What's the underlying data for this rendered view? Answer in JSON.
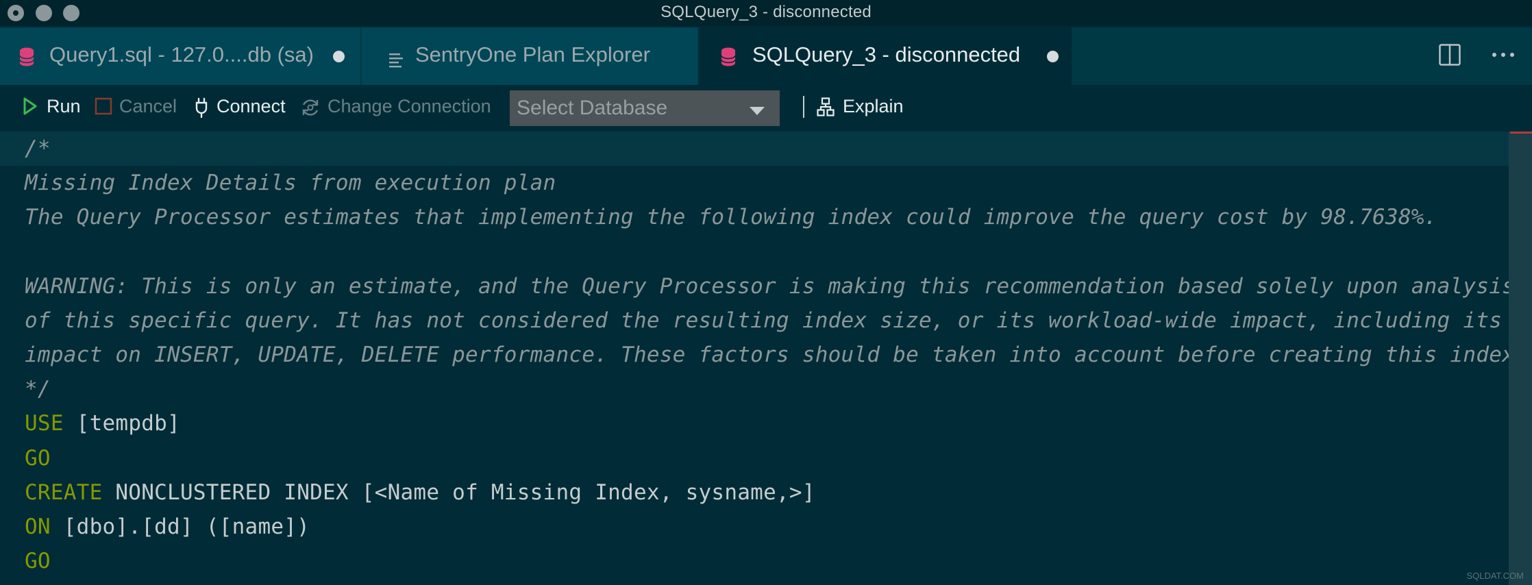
{
  "window": {
    "title": "SQLQuery_3 - disconnected",
    "controls": [
      "close-button",
      "minimize-button",
      "maximize-button"
    ]
  },
  "tabs": [
    {
      "label": "Query1.sql - 127.0....db (sa)",
      "icon": "database-icon",
      "dirty": true,
      "active": false
    },
    {
      "label": "SentryOne Plan Explorer",
      "icon": "lines-icon",
      "dirty": false,
      "active": false
    },
    {
      "label": "SQLQuery_3 - disconnected",
      "icon": "database-icon",
      "dirty": true,
      "active": true
    }
  ],
  "tabbar_actions": [
    "split-editor-icon",
    "more-actions-icon"
  ],
  "toolbar": {
    "run": "Run",
    "cancel": "Cancel",
    "connect": "Connect",
    "change_connection": "Change Connection",
    "database_placeholder": "Select Database",
    "explain": "Explain"
  },
  "editor": {
    "lines": [
      "/*",
      "Missing Index Details from execution plan",
      "The Query Processor estimates that implementing the following index could improve the query cost by 98.7638%.",
      "",
      "WARNING: This is only an estimate, and the Query Processor is making this recommendation based solely upon analysis",
      "of this specific query. It has not considered the resulting index size, or its workload-wide impact, including its",
      "impact on INSERT, UPDATE, DELETE performance. These factors should be taken into account before creating this index.",
      "*/",
      "USE",
      " [tempdb]",
      "GO",
      "CREATE",
      " NONCLUSTERED INDEX [<Name of Missing Index, sysname,>]",
      "ON",
      " [dbo].[dd] ([name])",
      "GO"
    ]
  },
  "colors": {
    "background": "#012b36",
    "keyword": "#859900",
    "comment": "#8a979a",
    "database_icon": "#e0407a",
    "run_icon": "#3fb950"
  },
  "watermark": "SQLDAT.COM"
}
